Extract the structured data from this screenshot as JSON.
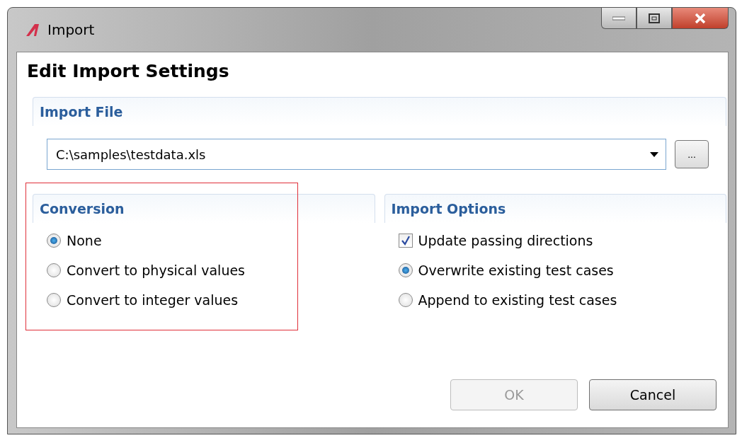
{
  "window": {
    "title": "Import"
  },
  "heading": "Edit Import Settings",
  "import_file": {
    "title": "Import File",
    "value": "C:\\samples\\testdata.xls",
    "browse_label": "..."
  },
  "groups": [
    {
      "title": "Conversion",
      "highlighted": true,
      "options": [
        {
          "kind": "radio",
          "label": "None",
          "selected": true
        },
        {
          "kind": "radio",
          "label": "Convert to physical values",
          "selected": false
        },
        {
          "kind": "radio",
          "label": "Convert to integer values",
          "selected": false
        }
      ]
    },
    {
      "title": "Import Options",
      "highlighted": false,
      "options": [
        {
          "kind": "checkbox",
          "label": "Update passing directions",
          "checked": true
        },
        {
          "kind": "radio",
          "label": "Overwrite existing test cases",
          "selected": true
        },
        {
          "kind": "radio",
          "label": "Append to existing test cases",
          "selected": false
        }
      ]
    }
  ],
  "buttons": [
    {
      "label": "OK",
      "disabled": true
    },
    {
      "label": "Cancel",
      "disabled": false
    }
  ]
}
